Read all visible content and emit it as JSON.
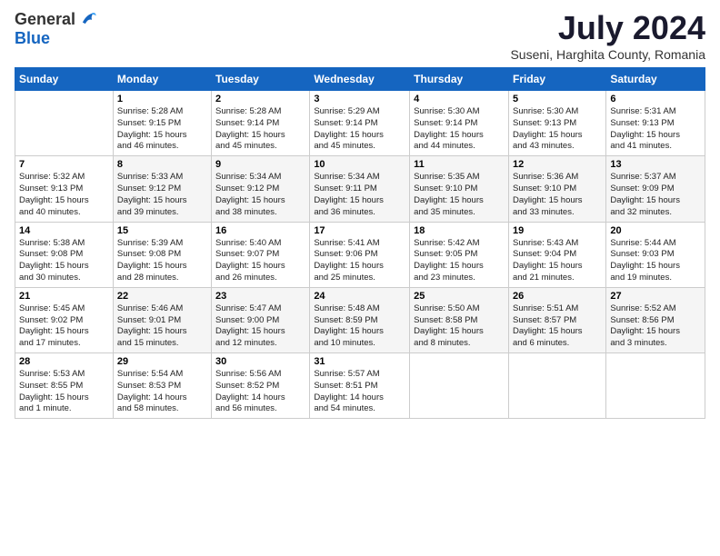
{
  "logo": {
    "general": "General",
    "blue": "Blue"
  },
  "title": "July 2024",
  "location": "Suseni, Harghita County, Romania",
  "days_of_week": [
    "Sunday",
    "Monday",
    "Tuesday",
    "Wednesday",
    "Thursday",
    "Friday",
    "Saturday"
  ],
  "weeks": [
    [
      {
        "day": "",
        "info": ""
      },
      {
        "day": "1",
        "info": "Sunrise: 5:28 AM\nSunset: 9:15 PM\nDaylight: 15 hours\nand 46 minutes."
      },
      {
        "day": "2",
        "info": "Sunrise: 5:28 AM\nSunset: 9:14 PM\nDaylight: 15 hours\nand 45 minutes."
      },
      {
        "day": "3",
        "info": "Sunrise: 5:29 AM\nSunset: 9:14 PM\nDaylight: 15 hours\nand 45 minutes."
      },
      {
        "day": "4",
        "info": "Sunrise: 5:30 AM\nSunset: 9:14 PM\nDaylight: 15 hours\nand 44 minutes."
      },
      {
        "day": "5",
        "info": "Sunrise: 5:30 AM\nSunset: 9:13 PM\nDaylight: 15 hours\nand 43 minutes."
      },
      {
        "day": "6",
        "info": "Sunrise: 5:31 AM\nSunset: 9:13 PM\nDaylight: 15 hours\nand 41 minutes."
      }
    ],
    [
      {
        "day": "7",
        "info": "Sunrise: 5:32 AM\nSunset: 9:13 PM\nDaylight: 15 hours\nand 40 minutes."
      },
      {
        "day": "8",
        "info": "Sunrise: 5:33 AM\nSunset: 9:12 PM\nDaylight: 15 hours\nand 39 minutes."
      },
      {
        "day": "9",
        "info": "Sunrise: 5:34 AM\nSunset: 9:12 PM\nDaylight: 15 hours\nand 38 minutes."
      },
      {
        "day": "10",
        "info": "Sunrise: 5:34 AM\nSunset: 9:11 PM\nDaylight: 15 hours\nand 36 minutes."
      },
      {
        "day": "11",
        "info": "Sunrise: 5:35 AM\nSunset: 9:10 PM\nDaylight: 15 hours\nand 35 minutes."
      },
      {
        "day": "12",
        "info": "Sunrise: 5:36 AM\nSunset: 9:10 PM\nDaylight: 15 hours\nand 33 minutes."
      },
      {
        "day": "13",
        "info": "Sunrise: 5:37 AM\nSunset: 9:09 PM\nDaylight: 15 hours\nand 32 minutes."
      }
    ],
    [
      {
        "day": "14",
        "info": "Sunrise: 5:38 AM\nSunset: 9:08 PM\nDaylight: 15 hours\nand 30 minutes."
      },
      {
        "day": "15",
        "info": "Sunrise: 5:39 AM\nSunset: 9:08 PM\nDaylight: 15 hours\nand 28 minutes."
      },
      {
        "day": "16",
        "info": "Sunrise: 5:40 AM\nSunset: 9:07 PM\nDaylight: 15 hours\nand 26 minutes."
      },
      {
        "day": "17",
        "info": "Sunrise: 5:41 AM\nSunset: 9:06 PM\nDaylight: 15 hours\nand 25 minutes."
      },
      {
        "day": "18",
        "info": "Sunrise: 5:42 AM\nSunset: 9:05 PM\nDaylight: 15 hours\nand 23 minutes."
      },
      {
        "day": "19",
        "info": "Sunrise: 5:43 AM\nSunset: 9:04 PM\nDaylight: 15 hours\nand 21 minutes."
      },
      {
        "day": "20",
        "info": "Sunrise: 5:44 AM\nSunset: 9:03 PM\nDaylight: 15 hours\nand 19 minutes."
      }
    ],
    [
      {
        "day": "21",
        "info": "Sunrise: 5:45 AM\nSunset: 9:02 PM\nDaylight: 15 hours\nand 17 minutes."
      },
      {
        "day": "22",
        "info": "Sunrise: 5:46 AM\nSunset: 9:01 PM\nDaylight: 15 hours\nand 15 minutes."
      },
      {
        "day": "23",
        "info": "Sunrise: 5:47 AM\nSunset: 9:00 PM\nDaylight: 15 hours\nand 12 minutes."
      },
      {
        "day": "24",
        "info": "Sunrise: 5:48 AM\nSunset: 8:59 PM\nDaylight: 15 hours\nand 10 minutes."
      },
      {
        "day": "25",
        "info": "Sunrise: 5:50 AM\nSunset: 8:58 PM\nDaylight: 15 hours\nand 8 minutes."
      },
      {
        "day": "26",
        "info": "Sunrise: 5:51 AM\nSunset: 8:57 PM\nDaylight: 15 hours\nand 6 minutes."
      },
      {
        "day": "27",
        "info": "Sunrise: 5:52 AM\nSunset: 8:56 PM\nDaylight: 15 hours\nand 3 minutes."
      }
    ],
    [
      {
        "day": "28",
        "info": "Sunrise: 5:53 AM\nSunset: 8:55 PM\nDaylight: 15 hours\nand 1 minute."
      },
      {
        "day": "29",
        "info": "Sunrise: 5:54 AM\nSunset: 8:53 PM\nDaylight: 14 hours\nand 58 minutes."
      },
      {
        "day": "30",
        "info": "Sunrise: 5:56 AM\nSunset: 8:52 PM\nDaylight: 14 hours\nand 56 minutes."
      },
      {
        "day": "31",
        "info": "Sunrise: 5:57 AM\nSunset: 8:51 PM\nDaylight: 14 hours\nand 54 minutes."
      },
      {
        "day": "",
        "info": ""
      },
      {
        "day": "",
        "info": ""
      },
      {
        "day": "",
        "info": ""
      }
    ]
  ]
}
